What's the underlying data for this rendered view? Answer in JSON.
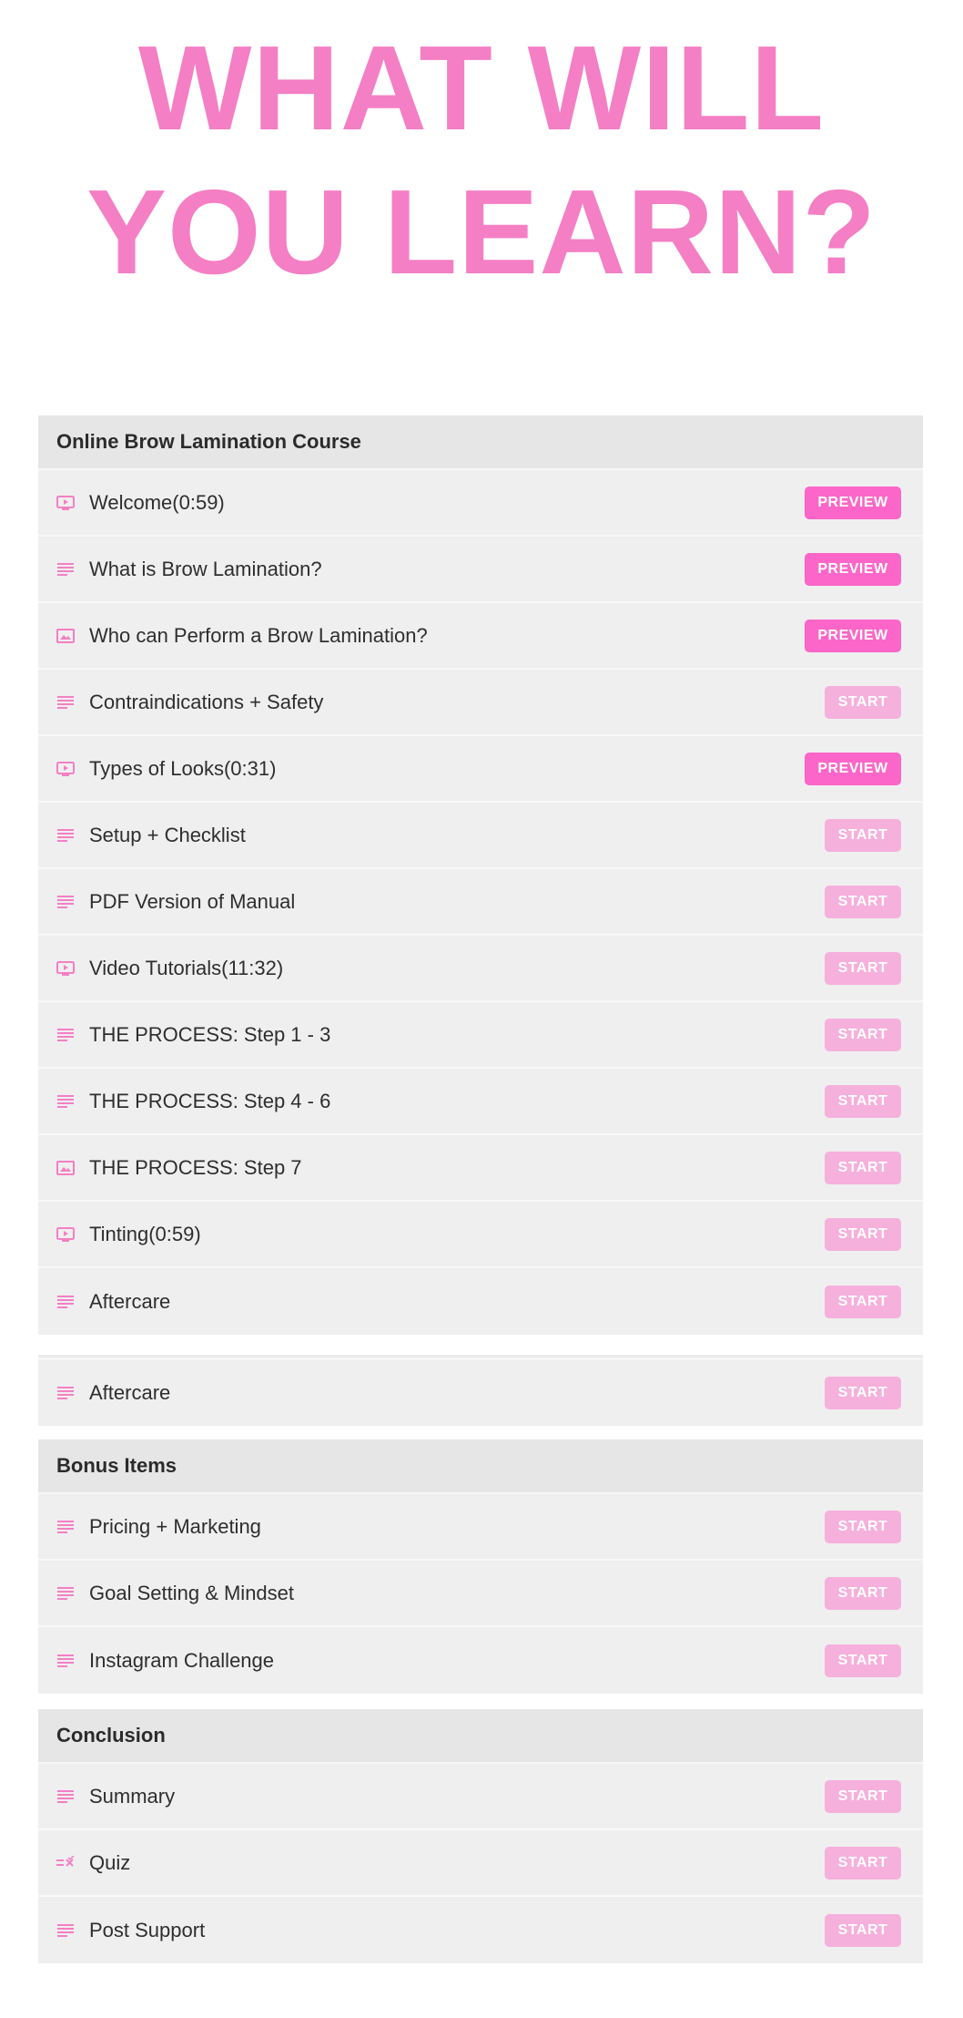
{
  "hero": {
    "title": "WHAT WILL YOU LEARN?"
  },
  "colors": {
    "accent": "#f47fc4",
    "preview_button": "#fb66c8",
    "start_button": "#f6b0dc",
    "row_bg": "#efefef",
    "header_bg": "#e6e6e6"
  },
  "course": {
    "title": "Online Brow Lamination Course",
    "lessons": [
      {
        "label": "Welcome(0:59)",
        "icon": "video-icon",
        "button": "PREVIEW"
      },
      {
        "label": "What is Brow Lamination?",
        "icon": "text-lines-icon",
        "button": "PREVIEW"
      },
      {
        "label": "Who can Perform a Brow Lamination?",
        "icon": "image-icon",
        "button": "PREVIEW"
      },
      {
        "label": "Contraindications + Safety",
        "icon": "text-lines-icon",
        "button": "START"
      },
      {
        "label": "Types of Looks(0:31)",
        "icon": "video-icon",
        "button": "PREVIEW"
      },
      {
        "label": "Setup + Checklist",
        "icon": "text-lines-icon",
        "button": "START"
      },
      {
        "label": "PDF Version of Manual",
        "icon": "text-lines-icon",
        "button": "START"
      },
      {
        "label": "Video Tutorials(11:32)",
        "icon": "video-icon",
        "button": "START"
      },
      {
        "label": "THE PROCESS: Step 1 - 3",
        "icon": "text-lines-icon",
        "button": "START"
      },
      {
        "label": "THE PROCESS: Step 4 - 6",
        "icon": "text-lines-icon",
        "button": "START"
      },
      {
        "label": "THE PROCESS: Step 7",
        "icon": "image-icon",
        "button": "START"
      },
      {
        "label": "Tinting(0:59)",
        "icon": "video-icon",
        "button": "START"
      },
      {
        "label": "Aftercare",
        "icon": "text-lines-icon",
        "button": "START"
      }
    ]
  },
  "extra": {
    "lessons": [
      {
        "label": "Aftercare",
        "icon": "text-lines-icon",
        "button": "START"
      }
    ]
  },
  "bonus": {
    "title": "Bonus Items",
    "lessons": [
      {
        "label": "Pricing + Marketing",
        "icon": "text-lines-icon",
        "button": "START"
      },
      {
        "label": "Goal Setting & Mindset",
        "icon": "text-lines-icon",
        "button": "START"
      },
      {
        "label": "Instagram Challenge",
        "icon": "text-lines-icon",
        "button": "START"
      }
    ]
  },
  "conclusion": {
    "title": "Conclusion",
    "lessons": [
      {
        "label": "Summary",
        "icon": "text-lines-icon",
        "button": "START"
      },
      {
        "label": "Quiz",
        "icon": "quiz-icon",
        "button": "START"
      },
      {
        "label": "Post Support",
        "icon": "text-lines-icon",
        "button": "START"
      }
    ]
  }
}
